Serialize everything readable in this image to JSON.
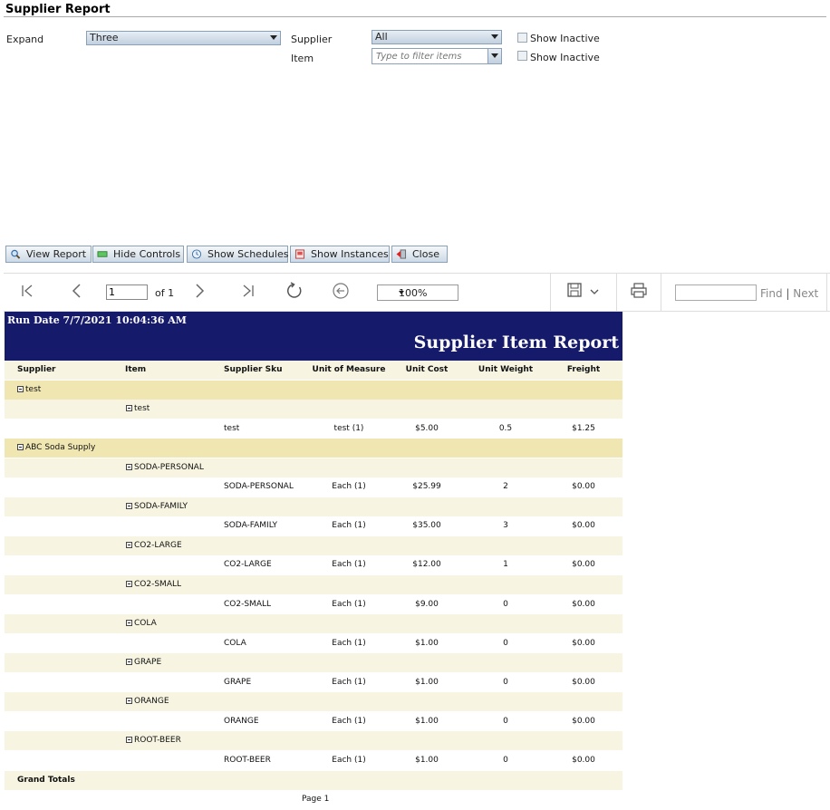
{
  "page": {
    "title": "Supplier Report"
  },
  "controls": {
    "expand_label": "Expand",
    "expand_value": "Three",
    "supplier_label": "Supplier",
    "supplier_value": "All",
    "item_label": "Item",
    "item_placeholder": "Type to filter items",
    "show_inactive_label": "Show Inactive",
    "show_inactive_item_label": "Show Inactive"
  },
  "buttons": {
    "view_report": "View Report",
    "hide_controls": "Hide Controls",
    "show_schedules": "Show Schedules",
    "show_instances": "Show Instances",
    "close": "Close"
  },
  "viewer": {
    "page_number": "1",
    "page_of": "of 1",
    "zoom": "100%",
    "find": "Find",
    "separator": "|",
    "next": "Next"
  },
  "report": {
    "run_date": "Run Date 7/7/2021 10:04:36 AM",
    "title": "Supplier Item Report",
    "columns": [
      "Supplier",
      "Item",
      "Supplier Sku",
      "Unit of Measure",
      "Unit Cost",
      "Unit Weight",
      "Freight"
    ],
    "rows": [
      {
        "type": "supplier",
        "supplier": "test"
      },
      {
        "type": "item",
        "item": "test"
      },
      {
        "type": "detail",
        "sku": "test",
        "uom": "test (1)",
        "cost": "$5.00",
        "weight": "0.5",
        "freight": "$1.25"
      },
      {
        "type": "supplier",
        "supplier": "ABC Soda Supply"
      },
      {
        "type": "item",
        "item": "SODA-PERSONAL"
      },
      {
        "type": "detail",
        "sku": "SODA-PERSONAL",
        "uom": "Each (1)",
        "cost": "$25.99",
        "weight": "2",
        "freight": "$0.00"
      },
      {
        "type": "item",
        "item": "SODA-FAMILY"
      },
      {
        "type": "detail",
        "sku": "SODA-FAMILY",
        "uom": "Each (1)",
        "cost": "$35.00",
        "weight": "3",
        "freight": "$0.00"
      },
      {
        "type": "item",
        "item": "CO2-LARGE"
      },
      {
        "type": "detail",
        "sku": "CO2-LARGE",
        "uom": "Each (1)",
        "cost": "$12.00",
        "weight": "1",
        "freight": "$0.00"
      },
      {
        "type": "item",
        "item": "CO2-SMALL"
      },
      {
        "type": "detail",
        "sku": "CO2-SMALL",
        "uom": "Each (1)",
        "cost": "$9.00",
        "weight": "0",
        "freight": "$0.00"
      },
      {
        "type": "item",
        "item": "COLA"
      },
      {
        "type": "detail",
        "sku": "COLA",
        "uom": "Each (1)",
        "cost": "$1.00",
        "weight": "0",
        "freight": "$0.00"
      },
      {
        "type": "item",
        "item": "GRAPE"
      },
      {
        "type": "detail",
        "sku": "GRAPE",
        "uom": "Each (1)",
        "cost": "$1.00",
        "weight": "0",
        "freight": "$0.00"
      },
      {
        "type": "item",
        "item": "ORANGE"
      },
      {
        "type": "detail",
        "sku": "ORANGE",
        "uom": "Each (1)",
        "cost": "$1.00",
        "weight": "0",
        "freight": "$0.00"
      },
      {
        "type": "item",
        "item": "ROOT-BEER"
      },
      {
        "type": "detail",
        "sku": "ROOT-BEER",
        "uom": "Each (1)",
        "cost": "$1.00",
        "weight": "0",
        "freight": "$0.00"
      }
    ],
    "grand_totals": "Grand Totals",
    "footer": "Page 1"
  },
  "colors": {
    "header_bg": "#161a6b",
    "supplier_row": "#f0e6b2",
    "item_row": "#f7f5e1",
    "detail_row": "#ffffff",
    "column_header_row": "#f7f5e1",
    "grand_totals_row": "#f7f5e1"
  }
}
